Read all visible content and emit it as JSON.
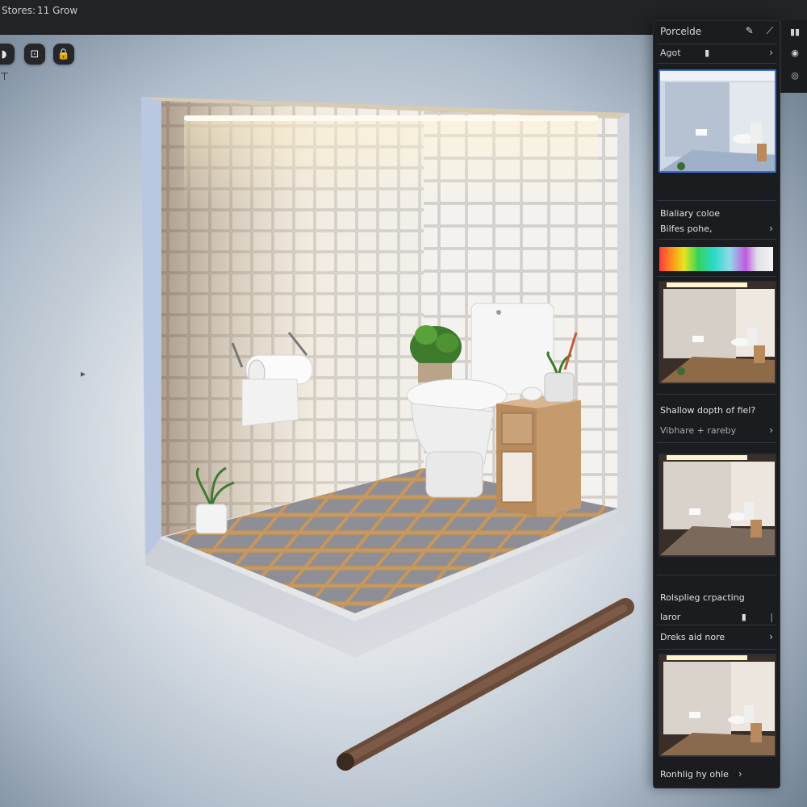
{
  "topbar": {
    "menu_a": "Stores:",
    "menu_b": "11 Grow"
  },
  "toolbar": {
    "buttons": [
      {
        "icon": "paint-bucket-icon",
        "glyph": "◗"
      },
      {
        "icon": "frame-icon",
        "glyph": "⊡"
      },
      {
        "icon": "lock-icon",
        "glyph": "🔒"
      }
    ],
    "extra_glyph": "⊤"
  },
  "panel": {
    "title": "Porcelde",
    "header_icons": [
      "✎",
      "⟋"
    ],
    "row1_label": "Agot",
    "row1_glyph": "▮",
    "section2_title": "Blaliary coloe",
    "section2_sub": "Bilfes pohe,",
    "section3_title": "Shallow dopth of fiel?",
    "section3_sub": "Vibhare + rareby",
    "section4_title": "Rolsplieg crpacting",
    "section4_row1": "laror",
    "section4_row2": "Dreks aid nore",
    "section5_title": "Ronhlig hy ohle",
    "chevron": "›"
  },
  "far_strip": {
    "icons": [
      "▮▮",
      "◉",
      "◎"
    ]
  },
  "colors": {
    "panel_bg": "#1b1c1f",
    "accent": "#3d6fd8"
  }
}
